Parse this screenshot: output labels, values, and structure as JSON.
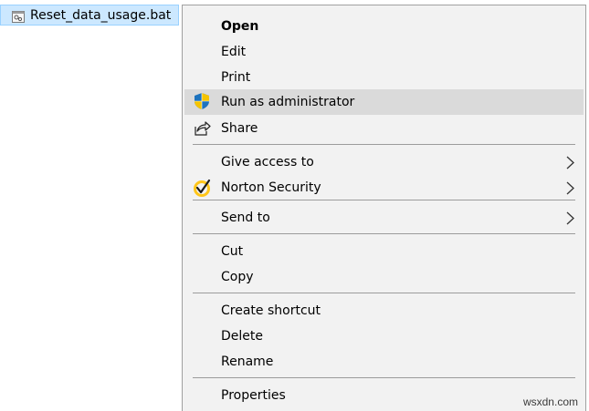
{
  "file": {
    "name": "Reset_data_usage.bat",
    "icon": "batch-file-icon"
  },
  "menu": {
    "open": "Open",
    "edit": "Edit",
    "print": "Print",
    "run_as_admin": "Run as administrator",
    "share": "Share",
    "give_access": "Give access to",
    "norton": "Norton Security",
    "send_to": "Send to",
    "cut": "Cut",
    "copy": "Copy",
    "create_shortcut": "Create shortcut",
    "delete": "Delete",
    "rename": "Rename",
    "properties": "Properties"
  },
  "watermark": "wsxdn.com",
  "colors": {
    "selection_bg": "#cce8ff",
    "selection_border": "#99d1ff",
    "menu_bg": "#f2f2f2",
    "hover_bg": "#dadada",
    "shield_blue": "#1e73be",
    "shield_yellow": "#f5c400",
    "norton_yellow": "#ffc61a"
  }
}
